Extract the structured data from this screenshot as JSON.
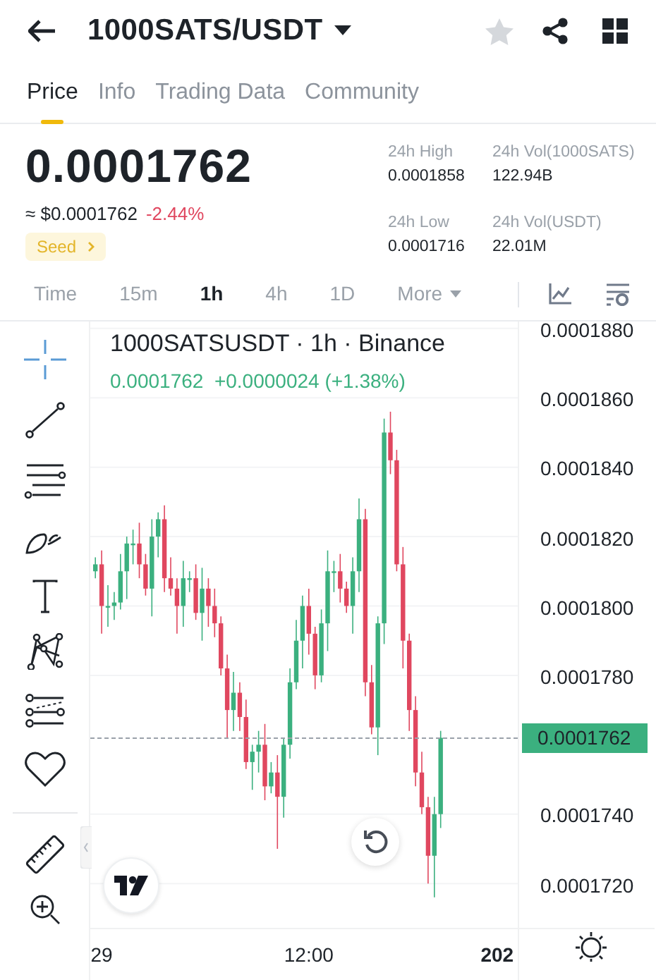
{
  "header": {
    "title": "1000SATS/USDT",
    "favorite": false
  },
  "tabs": [
    {
      "label": "Price",
      "selected": true
    },
    {
      "label": "Info",
      "selected": false
    },
    {
      "label": "Trading Data",
      "selected": false
    },
    {
      "label": "Community",
      "selected": false
    }
  ],
  "price": {
    "last": "0.0001762",
    "usd": "≈ $0.0001762",
    "change": "-2.44%",
    "badge": "Seed"
  },
  "stats": [
    {
      "label": "24h High",
      "value": "0.0001858"
    },
    {
      "label": "24h Vol(1000SATS)",
      "value": "122.94B"
    },
    {
      "label": "24h Low",
      "value": "0.0001716"
    },
    {
      "label": "24h Vol(USDT)",
      "value": "22.01M"
    }
  ],
  "timeframes": [
    {
      "label": "Time",
      "selected": false
    },
    {
      "label": "15m",
      "selected": false
    },
    {
      "label": "1h",
      "selected": true
    },
    {
      "label": "4h",
      "selected": false
    },
    {
      "label": "1D",
      "selected": false
    },
    {
      "label": "More",
      "selected": false
    }
  ],
  "chart": {
    "title": "1000SATSUSDT · 1h · Binance",
    "quote": "0.0001762  +0.0000024 (+1.38%)",
    "next_time_label": {
      "label": "202",
      "bold": true
    },
    "current_price": "0.0001762",
    "chart_data": {
      "type": "candlestick",
      "grid": true,
      "categories": [
        null,
        "29",
        null,
        null,
        null,
        null,
        null,
        null,
        null,
        null,
        null,
        null,
        null,
        null,
        null,
        null,
        null,
        null,
        null,
        null,
        null,
        null,
        null,
        null,
        null,
        null,
        null,
        null,
        null,
        null,
        null,
        null,
        null,
        null,
        "12:00",
        null,
        null,
        null,
        null,
        null,
        null,
        null,
        null,
        null,
        null,
        null,
        null,
        null,
        null,
        null,
        null,
        null,
        null,
        null,
        null,
        null
      ],
      "ylim": [
        0.0001693,
        0.0001882
      ],
      "yticks": [
        {
          "value": 0.000188,
          "label": "0.0001880"
        },
        {
          "value": 0.000186,
          "label": "0.0001860"
        },
        {
          "value": 0.000184,
          "label": "0.0001840"
        },
        {
          "value": 0.000182,
          "label": "0.0001820"
        },
        {
          "value": 0.00018,
          "label": "0.0001800"
        },
        {
          "value": 0.000178,
          "label": "0.0001780"
        },
        {
          "value": 0.000174,
          "label": "0.0001740"
        },
        {
          "value": 0.000172,
          "label": "0.0001720"
        }
      ],
      "ohlc": [
        [
          0.000181,
          0.0001814,
          0.0001808,
          0.0001812
        ],
        [
          0.0001812,
          0.0001816,
          0.0001792,
          0.00018
        ],
        [
          0.00018,
          0.0001806,
          0.0001794,
          0.00018
        ],
        [
          0.00018,
          0.0001804,
          0.0001796,
          0.0001801
        ],
        [
          0.0001801,
          0.0001815,
          0.0001799,
          0.000181
        ],
        [
          0.000181,
          0.000182,
          0.0001802,
          0.0001818
        ],
        [
          0.0001818,
          0.0001822,
          0.0001812,
          0.0001818
        ],
        [
          0.0001818,
          0.0001824,
          0.0001808,
          0.0001812
        ],
        [
          0.0001812,
          0.0001815,
          0.0001803,
          0.0001805
        ],
        [
          0.0001805,
          0.0001825,
          0.0001797,
          0.000182
        ],
        [
          0.000182,
          0.0001827,
          0.0001814,
          0.0001825
        ],
        [
          0.0001825,
          0.0001829,
          0.0001804,
          0.0001808
        ],
        [
          0.0001808,
          0.0001814,
          0.0001803,
          0.0001805
        ],
        [
          0.0001805,
          0.0001808,
          0.0001792,
          0.00018
        ],
        [
          0.00018,
          0.0001813,
          0.0001794,
          0.0001808
        ],
        [
          0.0001808,
          0.000181,
          0.0001804,
          0.0001808
        ],
        [
          0.0001808,
          0.0001812,
          0.0001796,
          0.0001798
        ],
        [
          0.0001798,
          0.0001811,
          0.000179,
          0.0001805
        ],
        [
          0.0001805,
          0.0001808,
          0.0001794,
          0.00018
        ],
        [
          0.00018,
          0.0001805,
          0.0001791,
          0.0001795
        ],
        [
          0.0001795,
          0.0001797,
          0.000178,
          0.0001782
        ],
        [
          0.0001782,
          0.0001786,
          0.0001762,
          0.000177
        ],
        [
          0.000177,
          0.0001781,
          0.0001764,
          0.0001775
        ],
        [
          0.0001775,
          0.0001778,
          0.0001764,
          0.0001768
        ],
        [
          0.0001768,
          0.0001773,
          0.0001753,
          0.0001755
        ],
        [
          0.0001755,
          0.000176,
          0.0001747,
          0.0001758
        ],
        [
          0.0001758,
          0.0001764,
          0.0001752,
          0.000176
        ],
        [
          0.000176,
          0.0001766,
          0.0001744,
          0.0001748
        ],
        [
          0.0001748,
          0.0001755,
          0.0001746,
          0.0001752
        ],
        [
          0.0001752,
          0.0001757,
          0.000173,
          0.0001745
        ],
        [
          0.0001745,
          0.0001762,
          0.0001739,
          0.000176
        ],
        [
          0.000176,
          0.0001782,
          0.0001756,
          0.0001778
        ],
        [
          0.0001778,
          0.0001796,
          0.0001776,
          0.000179
        ],
        [
          0.000179,
          0.0001803,
          0.0001782,
          0.00018
        ],
        [
          0.00018,
          0.0001805,
          0.0001786,
          0.0001792
        ],
        [
          0.0001792,
          0.0001794,
          0.0001776,
          0.000178
        ],
        [
          0.000178,
          0.0001799,
          0.0001778,
          0.0001795
        ],
        [
          0.0001795,
          0.0001816,
          0.0001787,
          0.000181
        ],
        [
          0.000181,
          0.0001813,
          0.0001804,
          0.000181
        ],
        [
          0.000181,
          0.0001815,
          0.0001801,
          0.0001805
        ],
        [
          0.0001805,
          0.0001807,
          0.0001798,
          0.00018
        ],
        [
          0.00018,
          0.0001814,
          0.0001792,
          0.000181
        ],
        [
          0.000181,
          0.0001831,
          0.0001804,
          0.0001825
        ],
        [
          0.0001825,
          0.0001828,
          0.0001774,
          0.0001778
        ],
        [
          0.0001778,
          0.0001783,
          0.0001763,
          0.0001765
        ],
        [
          0.0001765,
          0.0001797,
          0.0001757,
          0.0001795
        ],
        [
          0.0001795,
          0.0001854,
          0.0001789,
          0.000185
        ],
        [
          0.000185,
          0.0001856,
          0.0001838,
          0.0001842
        ],
        [
          0.0001842,
          0.0001845,
          0.000181,
          0.0001812
        ],
        [
          0.0001812,
          0.0001817,
          0.0001782,
          0.000179
        ],
        [
          0.000179,
          0.0001792,
          0.0001764,
          0.000177
        ],
        [
          0.000177,
          0.0001774,
          0.0001748,
          0.0001752
        ],
        [
          0.0001752,
          0.0001758,
          0.000174,
          0.0001742
        ],
        [
          0.0001742,
          0.0001745,
          0.000172,
          0.0001728
        ],
        [
          0.0001728,
          0.0001745,
          0.0001716,
          0.000174
        ],
        [
          0.000174,
          0.0001764,
          0.0001736,
          0.0001762
        ]
      ]
    }
  }
}
